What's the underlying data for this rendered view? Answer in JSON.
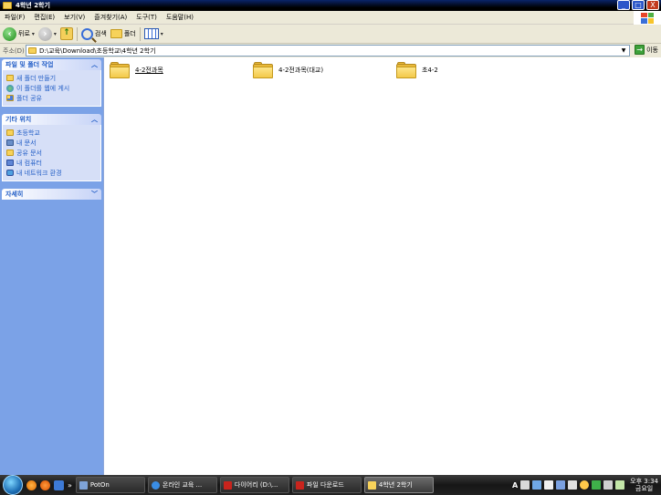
{
  "window": {
    "title": "4학년 2학기"
  },
  "window_buttons": {
    "minimize": "_",
    "maximize": "□",
    "close": "X"
  },
  "menu": [
    "파일(F)",
    "편집(E)",
    "보기(V)",
    "즐겨찾기(A)",
    "도구(T)",
    "도움말(H)"
  ],
  "toolbar": {
    "back_label": "뒤로",
    "search_label": "검색",
    "folders_label": "폴더"
  },
  "address": {
    "label": "주소(D)",
    "value": "D:\\교육\\Download\\초등학교\\4학년 2학기",
    "go_label": "이동"
  },
  "sidebar": {
    "tasks": {
      "title": "파일 및 폴더 작업",
      "items": [
        "새 폴더 만들기",
        "이 폴더를 웹에 게시",
        "폴더 공유"
      ]
    },
    "places": {
      "title": "기타 위치",
      "items": [
        "초등학교",
        "내 문서",
        "공유 문서",
        "내 컴퓨터",
        "내 네트워크 환경"
      ]
    },
    "details": {
      "title": "자세히"
    }
  },
  "files": [
    {
      "name": "4-2전과목"
    },
    {
      "name": "4-2전과목(대교)"
    },
    {
      "name": "초4-2"
    }
  ],
  "taskbar": {
    "quicklaunch_more": "»",
    "tasks": [
      "PotOn",
      "온라인 교육 ...",
      "다이어리 (D:\\...",
      "파일 다운로드",
      "4학년 2학기"
    ],
    "tray_text": "A",
    "clock_time": "오후 3:34",
    "clock_day": "금요일"
  },
  "colors": {
    "accent": "#215dc6",
    "sidebar_bg": "#7ba2e7",
    "titlebar": "#0a246a"
  }
}
